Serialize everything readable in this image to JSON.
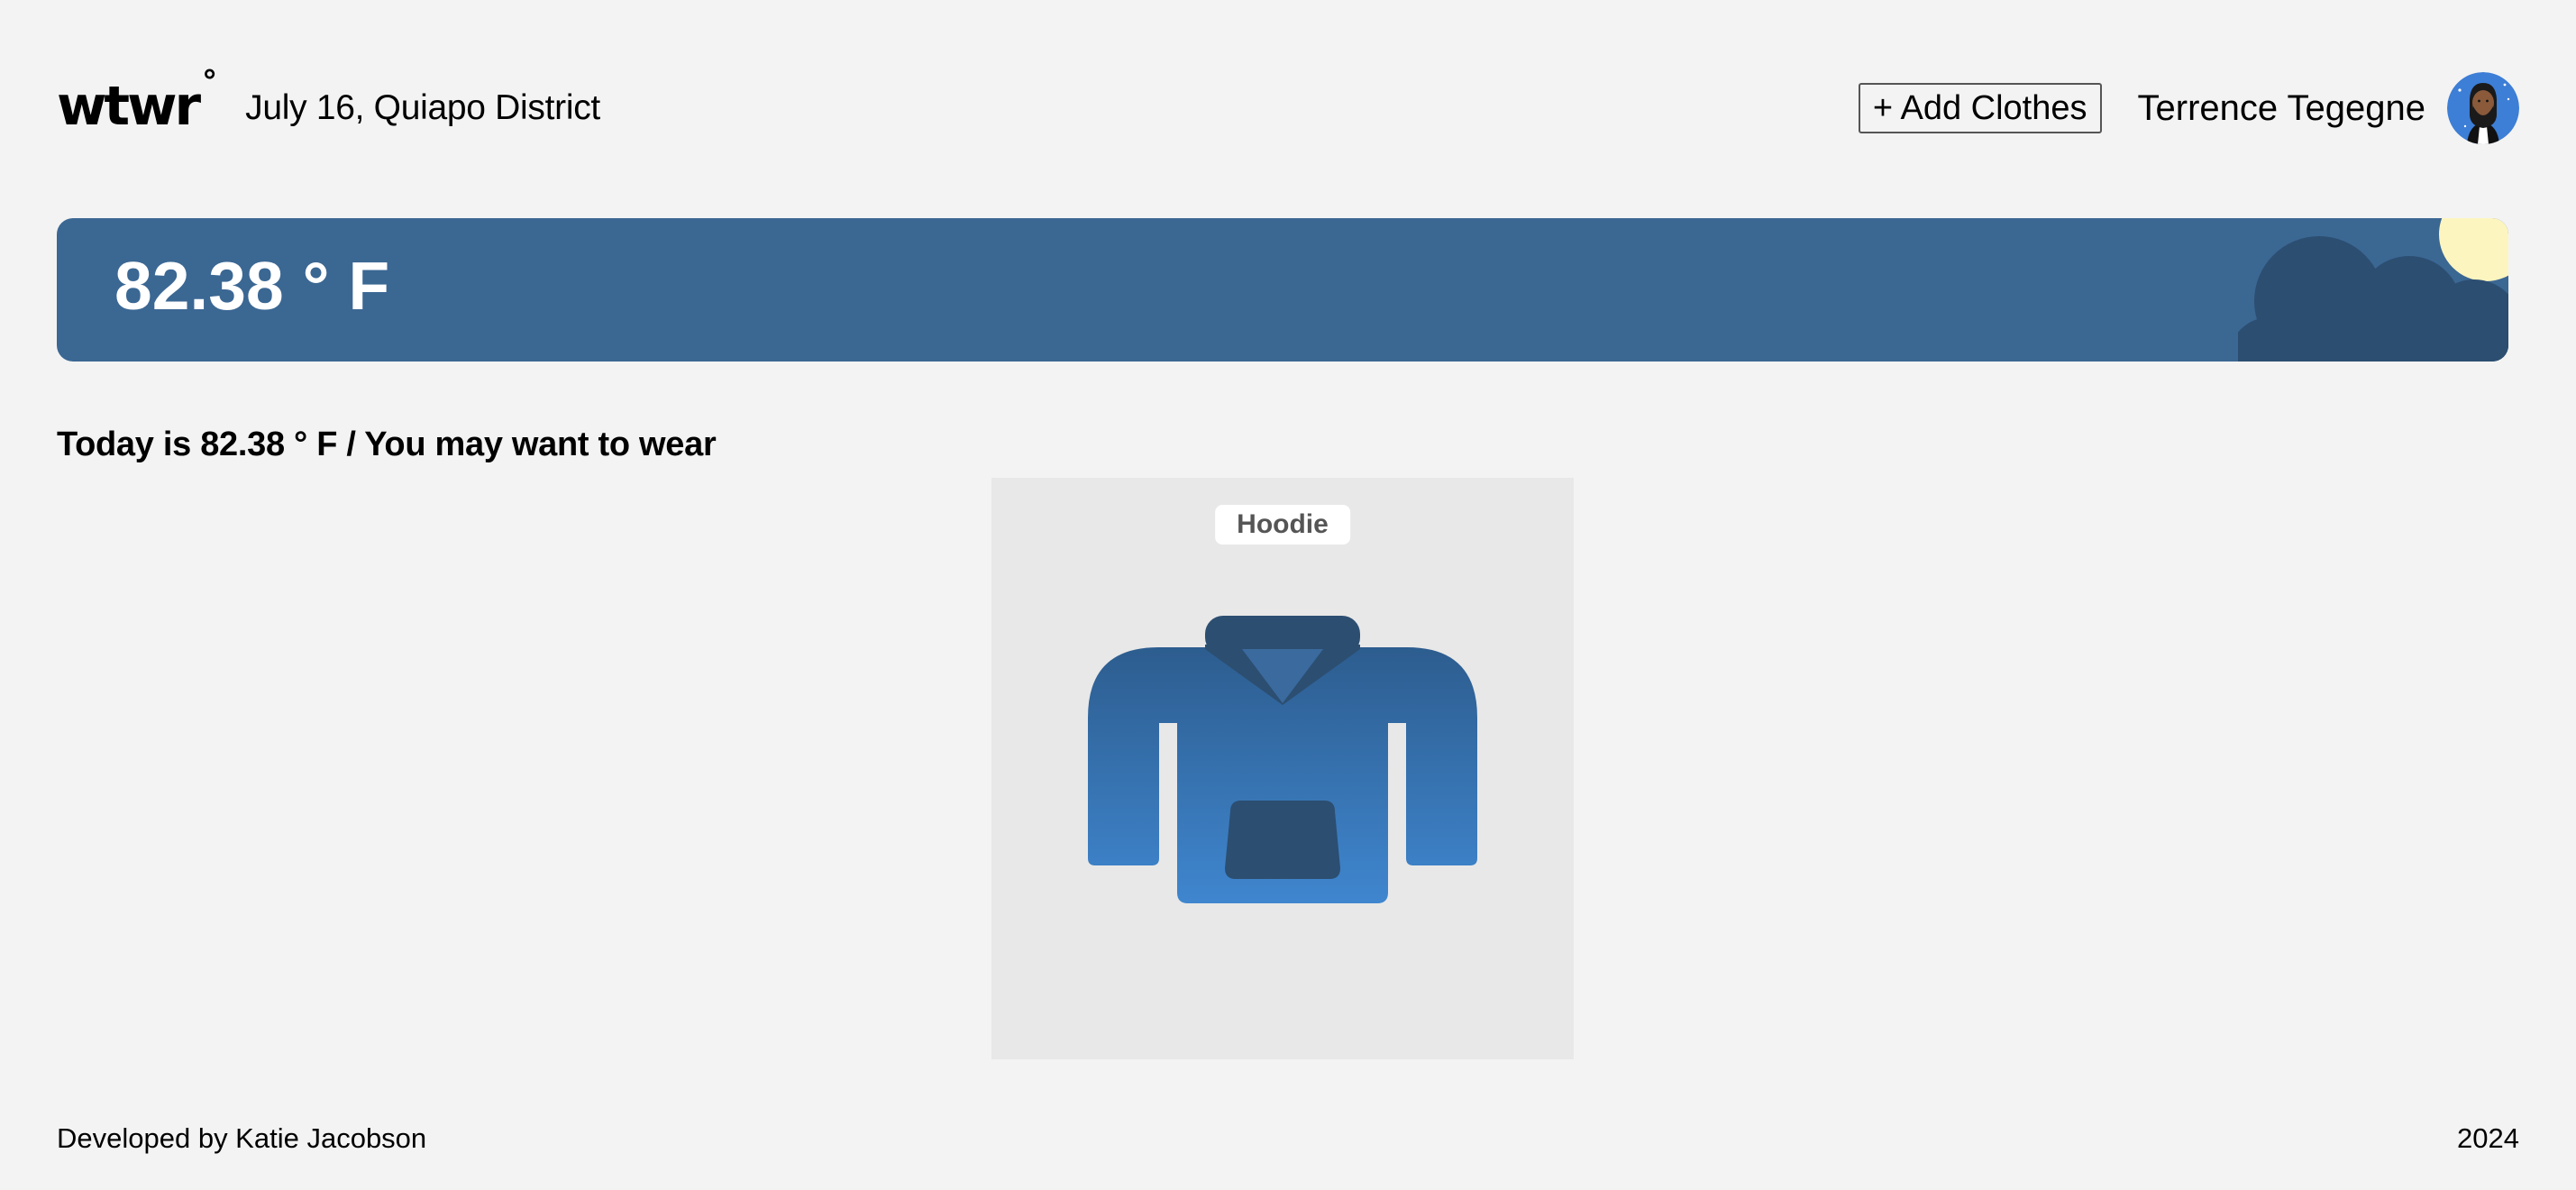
{
  "header": {
    "logo_text": "wtwr",
    "logo_degree": "°",
    "date_location": "July 16, Quiapo District",
    "add_clothes_label": "+ Add Clothes",
    "username": "Terrence Tegegne"
  },
  "weather": {
    "temperature": "82.38 ° F",
    "card_color": "#3b6793",
    "condition_icons": [
      "cloud-icon",
      "sun-icon"
    ]
  },
  "main": {
    "subtitle": "Today is 82.38 ° F / You may want to wear",
    "items": [
      {
        "name": "Hoodie",
        "icon": "hoodie-icon"
      }
    ]
  },
  "footer": {
    "developer": "Developed by Katie Jacobson",
    "year": "2024"
  },
  "colors": {
    "background": "#f3f3f3",
    "accent_blue": "#3b6793",
    "dark_navy": "#2c4e71",
    "hoodie_light": "#3f86cf",
    "sun_yellow": "#fdf5bf"
  }
}
